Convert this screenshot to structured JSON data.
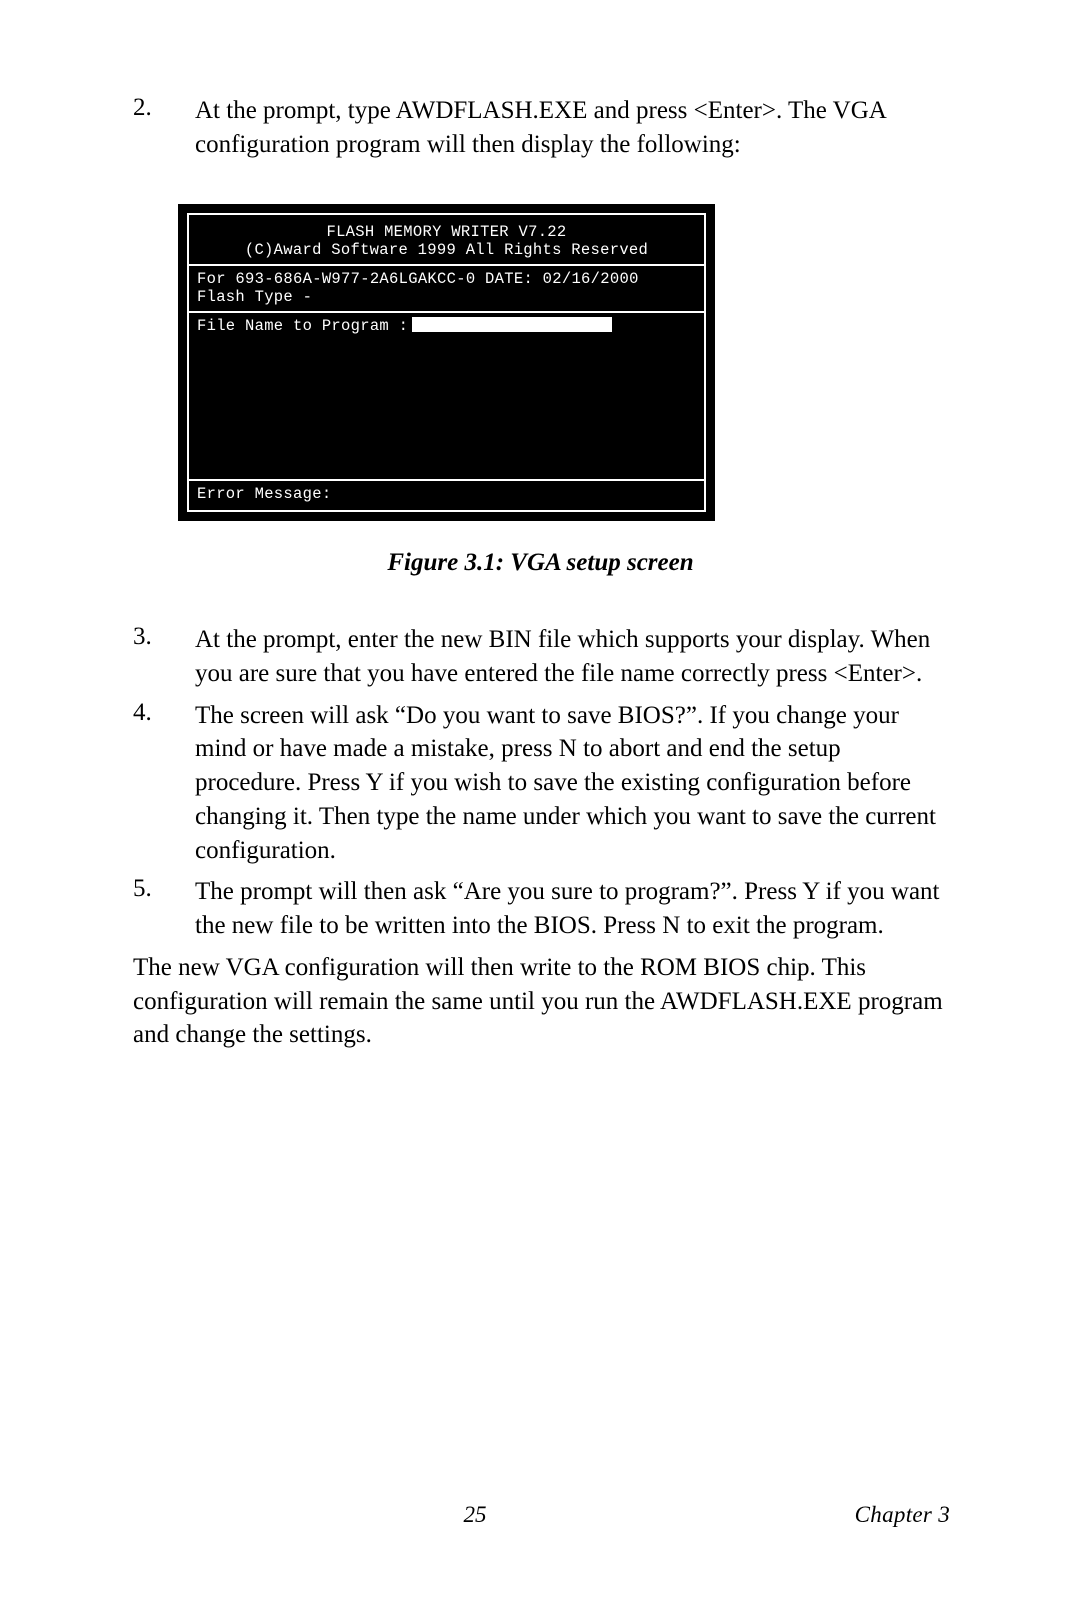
{
  "items": {
    "two": {
      "num": "2.",
      "text": "At the prompt, type AWDFLASH.EXE and press <Enter>. The VGA configuration program will then display the following:"
    },
    "three": {
      "num": "3.",
      "text": "At the prompt, enter the new BIN file which supports your display. When you are sure that you have entered the file name correctly press <Enter>."
    },
    "four": {
      "num": "4.",
      "text": "The screen will ask “Do you want to save BIOS?”. If you change your mind or have made a mistake, press N to abort and end the setup procedure. Press Y if you wish to save the existing configuration before changing it. Then type the name under which you want to save the current configuration."
    },
    "five": {
      "num": "5.",
      "text": "The prompt will then ask “Are you sure to program?”. Press Y if you want the new file to be written into the BIOS. Press N to exit the program."
    }
  },
  "terminal": {
    "title": "FLASH  MEMORY  WRITER V7.22",
    "copyright": "(C)Award Software 1999 All Rights Reserved",
    "bios_line": "For 693-686A-W977-2A6LGAKCC-0 DATE: 02/16/2000",
    "flash_type": "Flash Type -",
    "file_prompt": "File Name to Program :",
    "error_label": "Error Message:"
  },
  "figure_caption": "Figure 3.1: VGA setup screen",
  "closing_paragraph": "The new VGA configuration will then write to the ROM BIOS chip. This configuration will remain the same until you run the AWDFLASH.EXE program and change the settings.",
  "footer": {
    "page_number": "25",
    "chapter": "Chapter 3"
  }
}
